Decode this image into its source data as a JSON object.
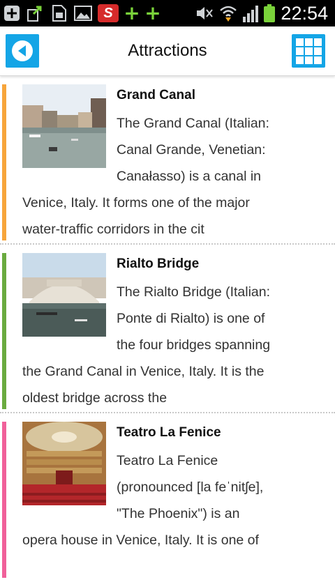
{
  "status_bar": {
    "time": "22:54",
    "left_icons": [
      "add-box-icon",
      "share-icon",
      "sd-card-icon",
      "image-icon",
      "s-app-icon",
      "plus-icon",
      "plus-icon"
    ],
    "right_icons": [
      "mute-icon",
      "wifi-icon",
      "signal-icon",
      "battery-icon"
    ]
  },
  "header": {
    "title": "Attractions",
    "back_icon": "back-icon",
    "grid_icon": "grid-icon",
    "accent": "#14a5e6"
  },
  "items": [
    {
      "name": "Grand Canal",
      "accent": "#f7a53b",
      "lines": [
        "The Grand Canal (Italian:",
        "Canal Grande, Venetian:",
        "Canałasso) is a canal in",
        "Venice, Italy. It forms one of the major",
        "water-traffic corridors in the cit"
      ]
    },
    {
      "name": "Rialto Bridge",
      "accent": "#6aaa3f",
      "lines": [
        "The Rialto Bridge (Italian:",
        "Ponte di Rialto) is one of",
        "the four bridges spanning",
        "the Grand Canal in Venice, Italy. It is the",
        "oldest bridge across the"
      ]
    },
    {
      "name": "Teatro La Fenice",
      "accent": "#f0609a",
      "lines": [
        "Teatro La Fenice",
        "(pronounced [la feˈnitʃe],",
        "\"The Phoenix\") is an",
        "opera house in Venice, Italy. It is one of"
      ]
    }
  ]
}
